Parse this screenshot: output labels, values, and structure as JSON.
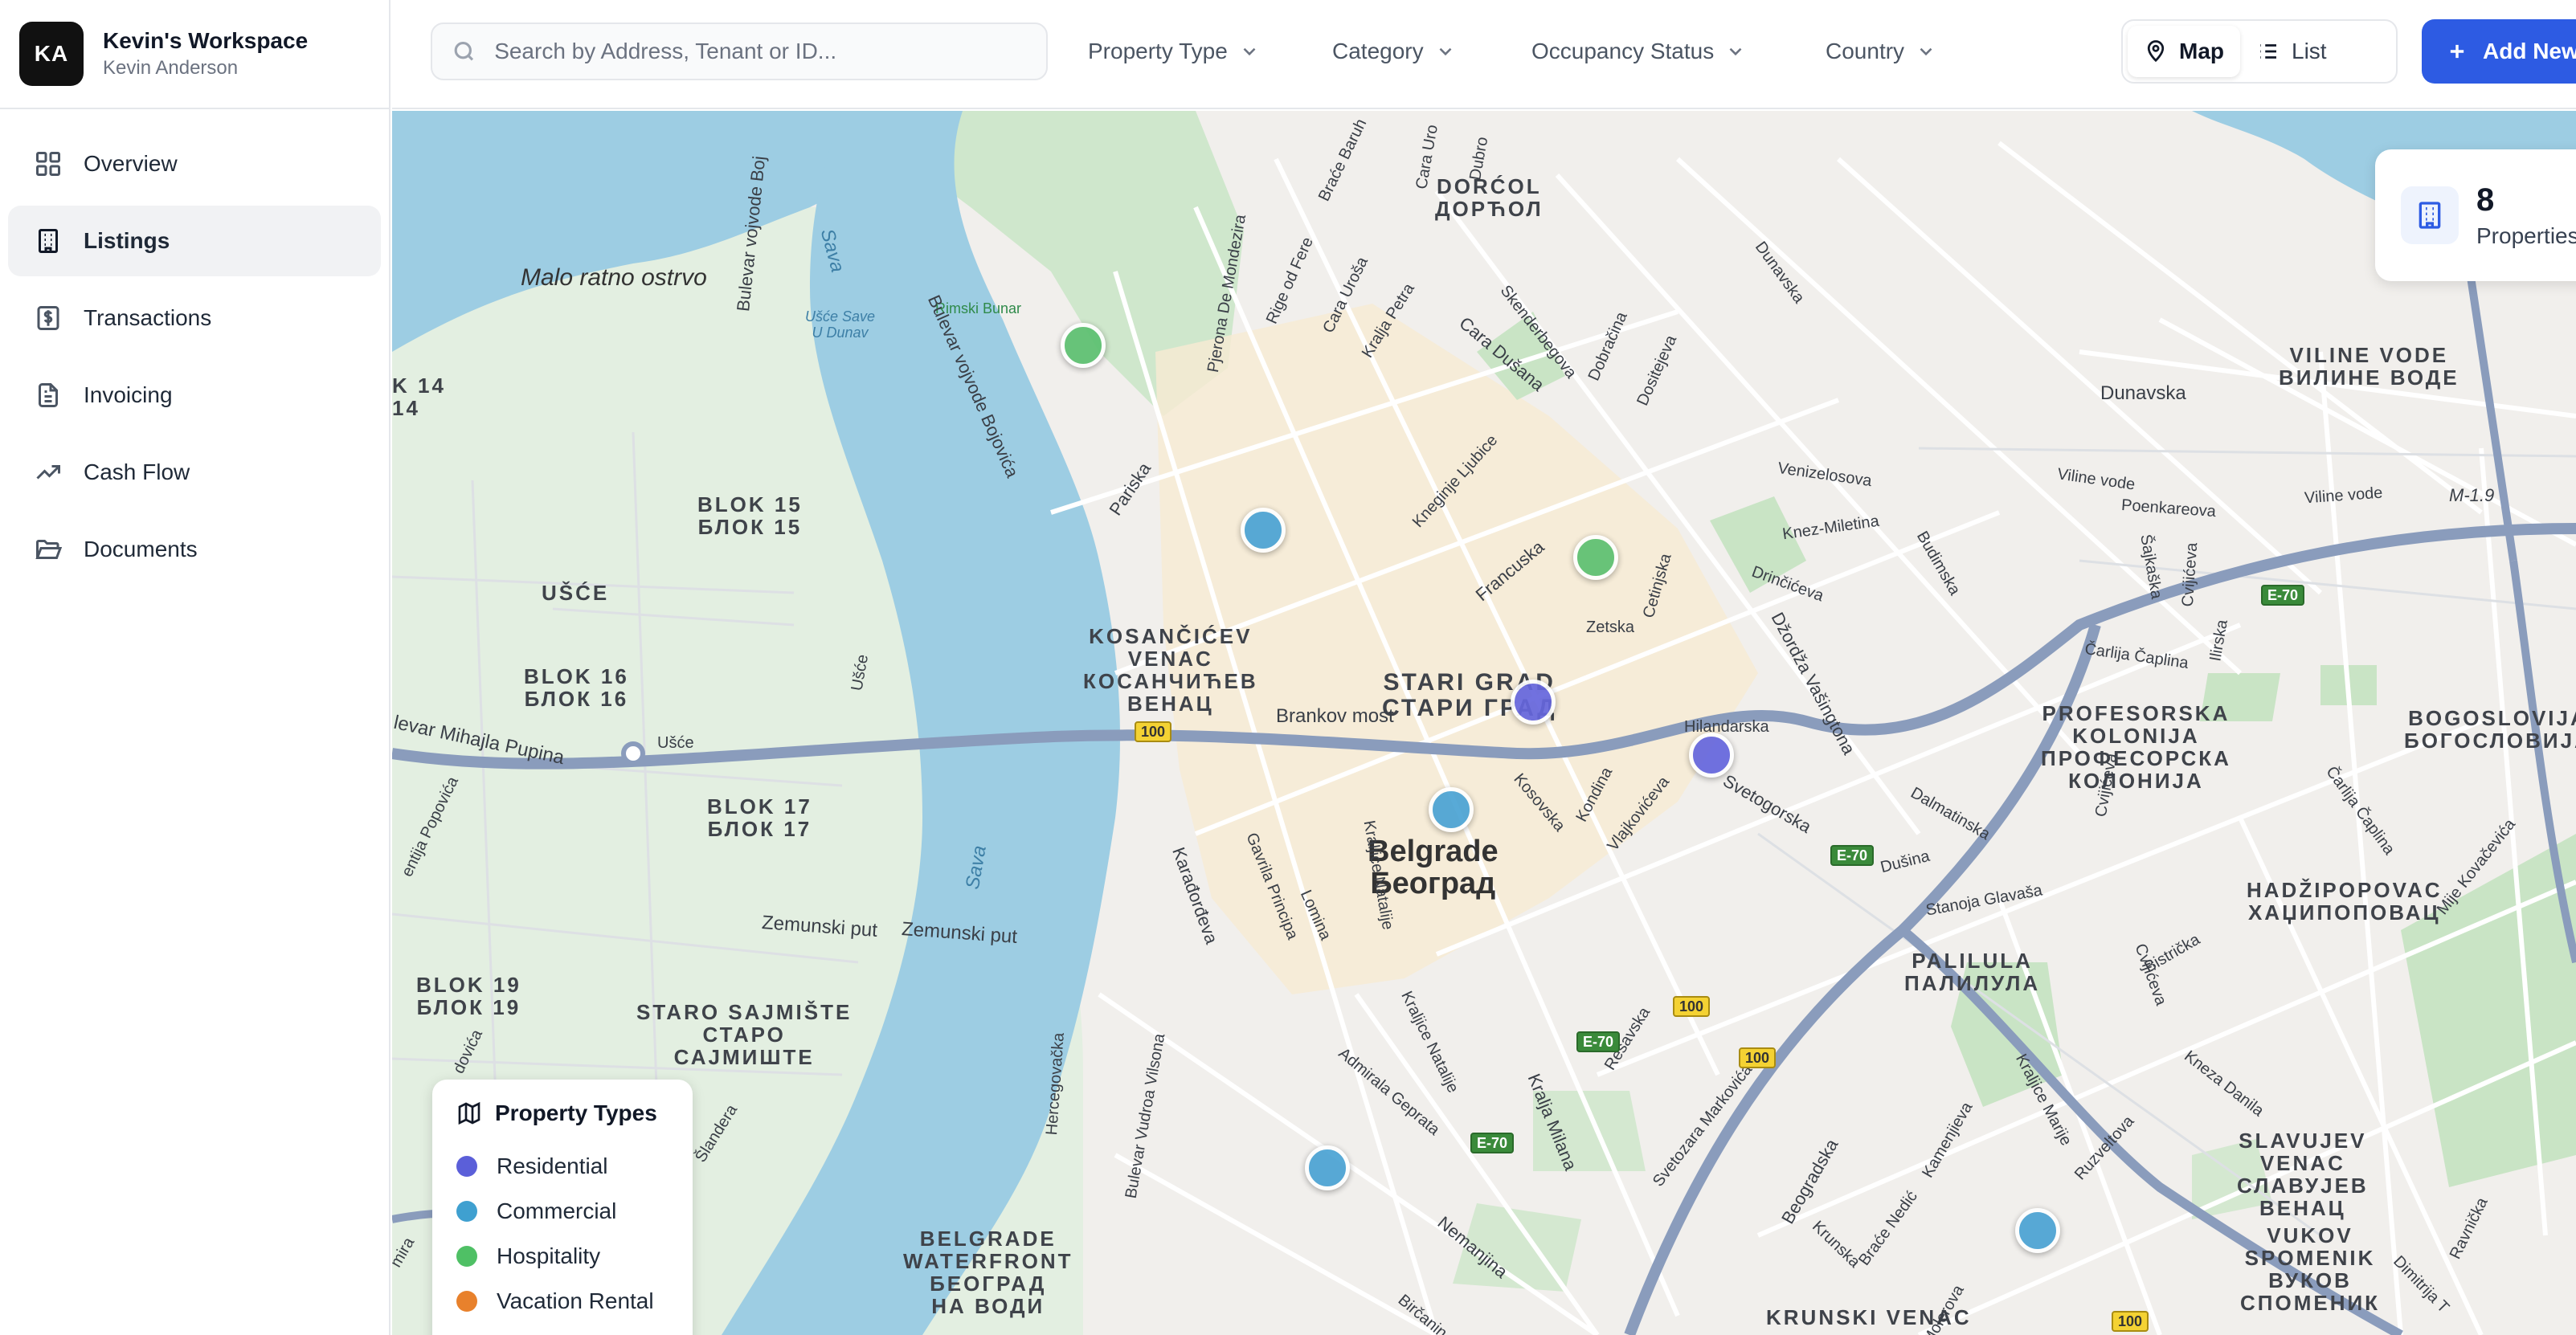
{
  "workspace": {
    "initials": "KA",
    "name": "Kevin's Workspace",
    "user": "Kevin Anderson"
  },
  "nav": [
    {
      "label": "Overview",
      "icon": "grid-icon",
      "active": false
    },
    {
      "label": "Listings",
      "icon": "building-icon",
      "active": true
    },
    {
      "label": "Transactions",
      "icon": "dollar-doc-icon",
      "active": false
    },
    {
      "label": "Invoicing",
      "icon": "file-text-icon",
      "active": false
    },
    {
      "label": "Cash Flow",
      "icon": "trend-up-icon",
      "active": false
    },
    {
      "label": "Documents",
      "icon": "folder-open-icon",
      "active": false
    }
  ],
  "toolbar": {
    "search_placeholder": "Search by Address, Tenant or ID...",
    "filters": [
      "Property Type",
      "Category",
      "Occupancy Status",
      "Country"
    ],
    "view_map": "Map",
    "view_list": "List",
    "active_view": "Map",
    "add_label": "Add New"
  },
  "stats": {
    "count": "8",
    "label": "Properties"
  },
  "legend": {
    "title": "Property Types",
    "items": [
      {
        "label": "Residential",
        "color": "#5b5fd9"
      },
      {
        "label": "Commercial",
        "color": "#3fa0d0"
      },
      {
        "label": "Hospitality",
        "color": "#4fc065"
      },
      {
        "label": "Vacation Rental",
        "color": "#e8812c"
      }
    ]
  },
  "markers": [
    {
      "type": "Hospitality",
      "color": "#5cc070"
    },
    {
      "type": "Commercial",
      "color": "#4aa3d4"
    },
    {
      "type": "Hospitality",
      "color": "#5cc070"
    },
    {
      "type": "Residential",
      "color": "#6566dd"
    },
    {
      "type": "Residential",
      "color": "#6566dd"
    },
    {
      "type": "Commercial",
      "color": "#4aa3d4"
    },
    {
      "type": "Commercial",
      "color": "#4aa3d4"
    },
    {
      "type": "Commercial",
      "color": "#4aa3d4"
    }
  ],
  "map": {
    "districts": {
      "dorcol": "DORĆOL\nДОРЋОЛ",
      "viline_vode": "VILINE VODE\nВИЛИНЕ ВОДЕ",
      "blok15": "BLOK 15\nБЛОК 15",
      "usce": "UŠĆE",
      "blok16": "BLOK 16\nБЛОК 16",
      "blok17": "BLOK 17\nБЛОК 17",
      "blok19": "BLOK 19\nБЛОК 19",
      "kosancicev": "KOSANČIĆEV\nVENAC\nКОСАНЧИЋЕВ\nВЕНАЦ",
      "stari_grad": "STARI GRAD\nСТАРИ ГРАД",
      "profesorska": "PROFESORSKA\nKOLONIJA\nПРОФЕСОРСКА\nКОЛОНИЈА",
      "bogoslovija": "BOGOSLOVIJA\nБОГОСЛОВИЈА",
      "hadzipopovac": "HADŽIPOPOVAC\nХАЏИПОПОВАЦ",
      "palilula": "PALILULA\nПАЛИЛУЛА",
      "staro_sajmiste": "STARO SAJMIŠTE\nСТАРО\nСАЈМИШТЕ",
      "waterfront": "BELGRADE\nWATERFRONT\nБЕОГРАД\nНА ВОДИ",
      "slavujev": "SLAVUJEV\nVENAC\nСЛАВУЈЕВ\nВЕНАЦ",
      "vukov": "VUKOV\nSPOMENIK\nВУКОВ\nСПОМЕНИК",
      "krunski": "KRUNSKI VENAC",
      "blok14": "K 14\n14"
    },
    "city": "Belgrade\nБеоград",
    "island": "Malo ratno\nostrvo",
    "usce_sava": "Ušće Save\nU Dunav",
    "rimski_bunar": "Rimski Bunar",
    "sava": "Sava",
    "sava2": "Sava",
    "dunavska": "Dunavska",
    "streets": {
      "zemunski1": "Zemunski put",
      "zemunski2": "Zemunski put",
      "brankov": "Brankov most",
      "usce_st": "Ušće",
      "usce_st2": "Ušće",
      "mihajla": "levar Mihajla Pupina",
      "bulevar_bojovica": "Bulevar vojvode Bojovića",
      "bulevar_bojovica2": "Bulevar vojvode Boj",
      "pariska": "Pariska",
      "francuska": "Francuska",
      "zetska": "Zetska",
      "cetinjska": "Cetinjska",
      "hilandarska": "Hilandarska",
      "svetogorska": "Svetogorska",
      "dzordza": "Džordža Vašingtona",
      "venizelosova": "Venizelosova",
      "knez_miletina": "Knez-Miletina",
      "drincicena": "Drinčićeva",
      "budimska": "Budimska",
      "dunavska_st": "Dunavska",
      "viline_vode_st": "Viline vode",
      "viline_vode_st2": "Viline vode",
      "poenkareova": "Poenkareova",
      "carlija": "Čarlija Čaplina",
      "carlija2": "Čarlija Čaplina",
      "cara_dusana": "Cara Dušana",
      "skenderbegova": "Skenderbegova",
      "dobracina": "Dobračina",
      "dositejeva": "Dositejeva",
      "kralja_petra": "Kralja Petra",
      "cara_urosa": "Cara Uroša",
      "rige_od_fere": "Rige od Fere",
      "pjerona": "Pjerona De Mondezira",
      "kneginje": "Kneginje Ljubice",
      "karadjordjeva": "Karađorđeva",
      "gavrila": "Gavrila Principa",
      "lomina": "Lomina",
      "kraljice_natalije": "Kraljice Natalije",
      "kraljice_natalije2": "Kraljice Natalije",
      "admirala": "Admirala Geprata",
      "kralja_milana": "Kralja Milana",
      "resavska": "Resavska",
      "svetozara": "Svetozara Markovića",
      "beogradska": "Beogradska",
      "kosovska": "Kosovska",
      "kondina": "Kondina",
      "vlajkoviceva": "Vlajkovićeva",
      "dalmatinska": "Dalmatinska",
      "dusina": "Dušina",
      "stanoja": "Stanoja Glavaša",
      "bistricka": "Bistrička",
      "cvijiceva": "Cvijićeva",
      "cvijiceva2": "Cvijićeva",
      "cvijiceva3": "Cvijićeva",
      "sajkaska": "Šajkaška",
      "ilirska": "Ilirska",
      "kneza_danila": "Kneza Danila",
      "kraljice_marije": "Kraljice Marije",
      "ruzveltova": "Ruzveltova",
      "kamenjieva": "Kamenjieva",
      "krunska": "Krunska",
      "brace_nedic": "Braće Nedić",
      "molerova": "Molerova",
      "nemanjina": "Nemanjina",
      "hercegovacka": "Hercegovačka",
      "bulevar_vudroa": "Bulevar Vudroa Vilsona",
      "dimitrija": "Dimitrija T",
      "mije": "Mije Kovačevića",
      "ravnicka": "Ravnička",
      "jentija": "entija Popovića",
      "dovica": "dovića",
      "slandera": "Šlandera",
      "mira": "mira",
      "m19": "M-1.9",
      "e70a": "E-70",
      "e70b": "E-70",
      "e70c": "E-70",
      "e70d": "E-70",
      "r100a": "100",
      "r100b": "100",
      "r100c": "100",
      "r100d": "100",
      "cara_uros2": "Cara Uro",
      "dubro": "Dubro",
      "brace_baruh": "Braće Baruh",
      "usce_sava_lbl": "Ušće",
      "bircanina": "Birčanin"
    }
  }
}
